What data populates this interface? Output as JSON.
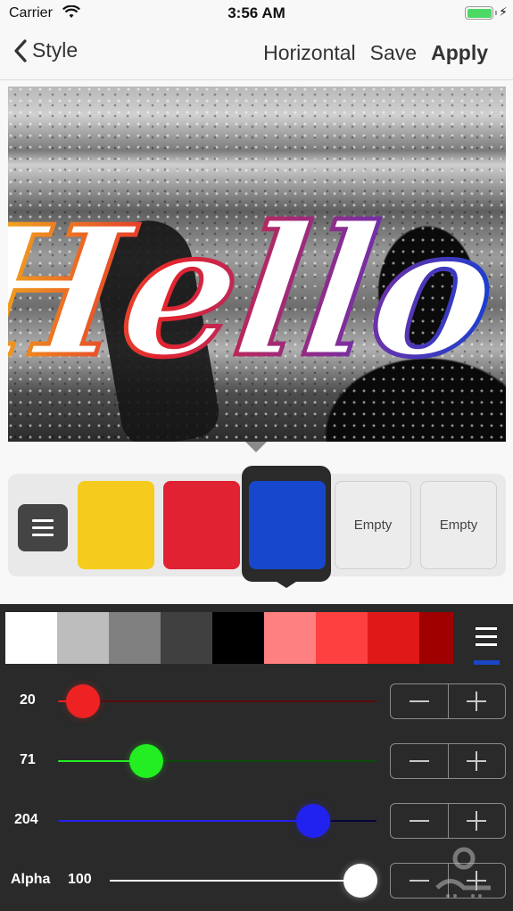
{
  "status_bar": {
    "carrier": "Carrier",
    "time": "3:56 AM",
    "battery_level": 1.0,
    "charging": true
  },
  "nav": {
    "back_label": "Style",
    "actions": {
      "horizontal": "Horizontal",
      "save": "Save",
      "apply": "Apply"
    }
  },
  "canvas": {
    "text": "Hello",
    "text_fill": "#ffffff",
    "stroke_gradient": [
      "#f5c518",
      "#e2242f",
      "#7b2fa0",
      "#1a3fd0"
    ]
  },
  "swatches": [
    {
      "type": "color",
      "color": "#f5cc1e",
      "label": ""
    },
    {
      "type": "color",
      "color": "#e12233",
      "label": ""
    },
    {
      "type": "color",
      "color": "#1747cc",
      "label": "",
      "selected": true
    },
    {
      "type": "empty",
      "label": "Empty"
    },
    {
      "type": "empty",
      "label": "Empty"
    }
  ],
  "palette": [
    "#ffffff",
    "#bdbdbd",
    "#808080",
    "#404040",
    "#000000",
    "#ff8080",
    "#ff4040",
    "#e01818",
    "#a00000"
  ],
  "sliders": {
    "red": {
      "label": "20",
      "value": 20,
      "max": 255,
      "color": "#ee2222",
      "track_dim": "#5a0a0a"
    },
    "green": {
      "label": "71",
      "value": 71,
      "max": 255,
      "color": "#22ee22",
      "track_dim": "#0a4a0a"
    },
    "blue": {
      "label": "204",
      "value": 204,
      "max": 255,
      "color": "#2222ee",
      "track_dim": "#05053a"
    },
    "alpha": {
      "name": "Alpha",
      "label": "100",
      "value": 100,
      "max": 100,
      "color": "#ffffff"
    }
  }
}
